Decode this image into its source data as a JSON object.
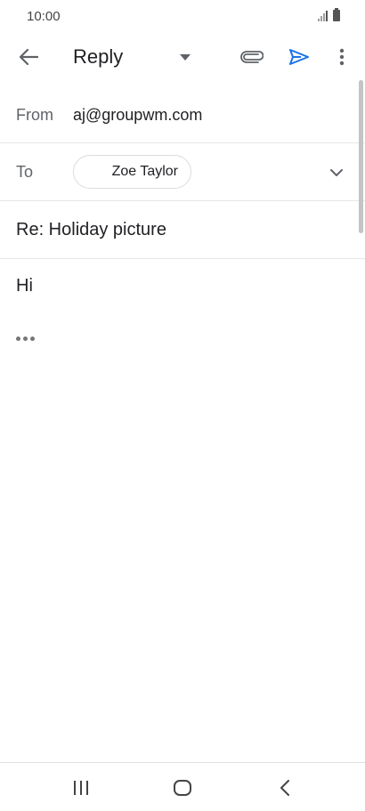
{
  "status_bar": {
    "time": "10:00"
  },
  "toolbar": {
    "title": "Reply",
    "icons": {
      "back": "arrow-left-icon",
      "dropdown": "caret-down-icon",
      "attach": "paperclip-icon",
      "send": "send-icon",
      "more": "more-vert-icon"
    },
    "send_color": "#1a73e8"
  },
  "from": {
    "label": "From",
    "value": "aj@groupwm.com"
  },
  "to": {
    "label": "To",
    "recipient": "Zoe Taylor"
  },
  "subject": {
    "value": "Re: Holiday picture"
  },
  "body": {
    "text": "Hi"
  },
  "nav_bar": {
    "icons": [
      "recent-apps-icon",
      "home-icon",
      "back-icon"
    ]
  }
}
